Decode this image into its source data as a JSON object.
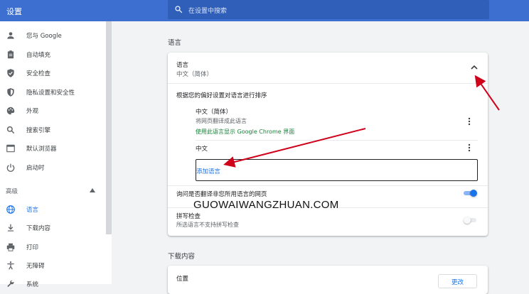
{
  "header": {
    "title": "设置",
    "search_placeholder": "在设置中搜索"
  },
  "sidebar": {
    "items": [
      {
        "label": "您与 Google",
        "icon": "person-icon"
      },
      {
        "label": "自动填充",
        "icon": "clipboard-icon"
      },
      {
        "label": "安全检查",
        "icon": "shield-check-icon"
      },
      {
        "label": "隐私设置和安全性",
        "icon": "shield-icon"
      },
      {
        "label": "外观",
        "icon": "palette-icon"
      },
      {
        "label": "搜索引擎",
        "icon": "search-icon"
      },
      {
        "label": "默认浏览器",
        "icon": "browser-icon"
      },
      {
        "label": "启动时",
        "icon": "power-icon"
      }
    ],
    "advanced_label": "高级",
    "advanced_items": [
      {
        "label": "语言",
        "icon": "globe-icon",
        "active": true
      },
      {
        "label": "下载内容",
        "icon": "download-icon"
      },
      {
        "label": "打印",
        "icon": "printer-icon"
      },
      {
        "label": "无障碍",
        "icon": "accessibility-icon"
      },
      {
        "label": "系统",
        "icon": "wrench-icon"
      }
    ]
  },
  "languages_section": {
    "title": "语言",
    "card_title": "语言",
    "card_subtitle": "中文（简体）",
    "order_text": "根据您的偏好设置对语言进行排序",
    "languages": [
      {
        "name": "中文（简体）",
        "note": "将网页翻译成此语言",
        "ui_note": "使用此语言显示 Google Chrome 界面"
      },
      {
        "name": "中文"
      }
    ],
    "add_language": "添加语言",
    "translate_label": "询问是否翻译非您所用语言的网页",
    "translate_enabled": true,
    "spellcheck_label": "拼写检查",
    "spellcheck_sub": "所选语言不支持拼写检查",
    "spellcheck_enabled": false
  },
  "downloads_section": {
    "title": "下载内容",
    "location_label": "位置",
    "change_button": "更改"
  },
  "watermark": "GUOWAIWANGZHUAN.COM",
  "colors": {
    "header": "#3c6fcf",
    "accent": "#1a73e8",
    "green_text": "#188038",
    "annotation_arrow": "#d0021b"
  }
}
